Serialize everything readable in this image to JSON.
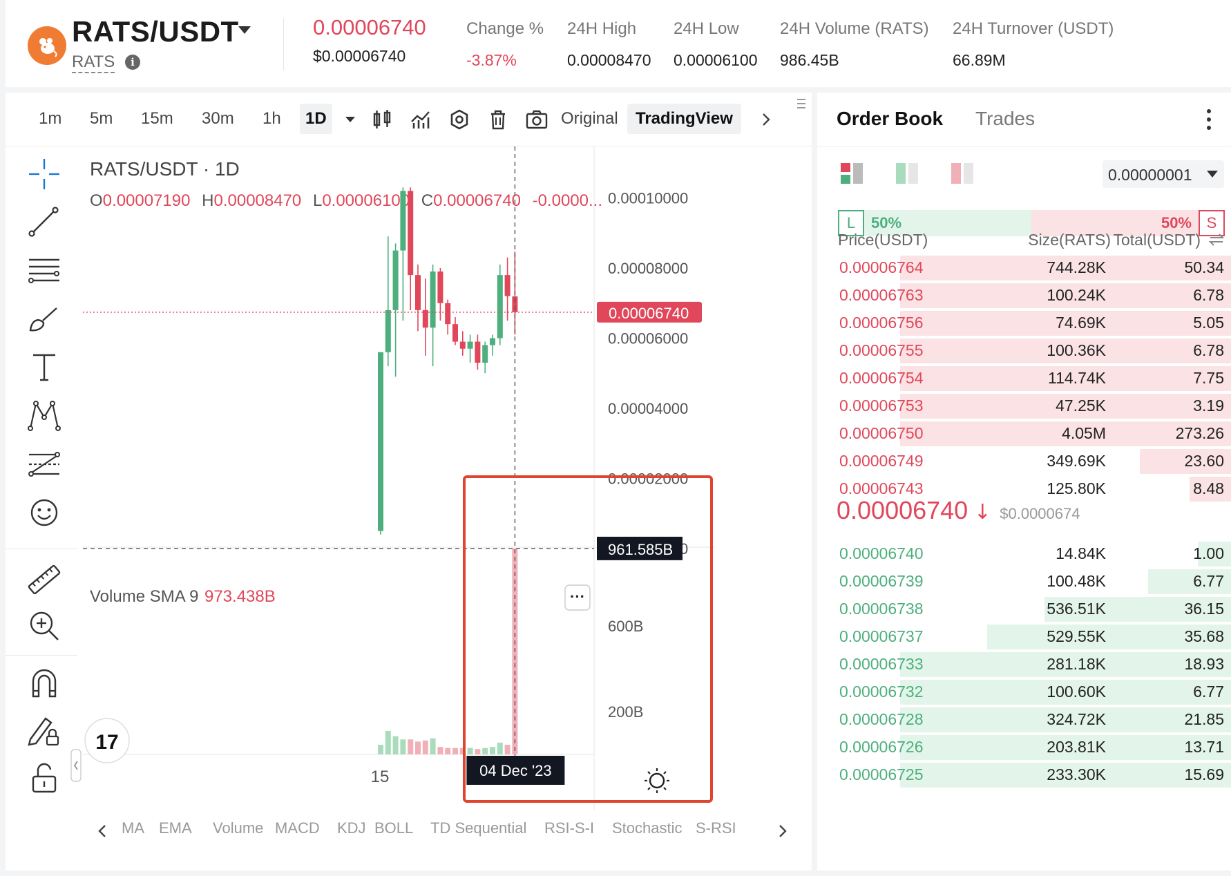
{
  "header": {
    "pair": "RATS/USDT",
    "base_symbol": "RATS",
    "info_glyph": "i",
    "last_price": "0.00006740",
    "last_price_usd": "$0.00006740",
    "stats": [
      {
        "label": "Change %",
        "value": "-3.87%",
        "color": "#e0475a"
      },
      {
        "label": "24H High",
        "value": "0.00008470",
        "color": "#222222"
      },
      {
        "label": "24H Low",
        "value": "0.00006100",
        "color": "#222222"
      },
      {
        "label": "24H Volume (RATS)",
        "value": "986.45B",
        "color": "#222222"
      },
      {
        "label": "24H Turnover (USDT)",
        "value": "66.89M",
        "color": "#222222"
      }
    ]
  },
  "toolbar": {
    "timeframes": [
      "1m",
      "5m",
      "15m",
      "30m",
      "1h",
      "1D"
    ],
    "active_timeframe": "1D",
    "view_original": "Original",
    "view_tradingview": "TradingView"
  },
  "chart": {
    "legend_title": "RATS/USDT · 1D",
    "ohlc": [
      {
        "k": "O",
        "v": "0.00007190"
      },
      {
        "k": "H",
        "v": "0.00008470"
      },
      {
        "k": "L",
        "v": "0.00006100"
      },
      {
        "k": "C",
        "v": "0.00006740"
      }
    ],
    "change_text": "-0.0000...",
    "volume_label": "Volume SMA 9",
    "volume_sma": "973.438B",
    "crosshair_volume": "961.585B",
    "crosshair_date": "04 Dec '23",
    "x_tick": "15",
    "more_glyph": "···",
    "tv_logo": "17",
    "price_axis": [
      "0.00010000",
      "0.00008000",
      "0.00006000",
      "0.00004000",
      "0.00002000",
      "0.00000000"
    ],
    "volume_axis": [
      "600B",
      "200B"
    ],
    "current_price_label": "0.00006740",
    "indicators": [
      "MA",
      "EMA",
      "Volume",
      "MACD",
      "KDJ",
      "BOLL",
      "TD Sequential",
      "RSI-S-I",
      "Stochastic",
      "S-RSI"
    ]
  },
  "chart_data": {
    "type": "candlestick",
    "title": "RATS/USDT · 1D",
    "ylim": [
      0,
      0.000106
    ],
    "volume_ylim": [
      0,
      1000
    ],
    "candles": [
      {
        "o": 5e-06,
        "h": 6e-06,
        "l": 4e-06,
        "c": 5.6e-05,
        "v": 45
      },
      {
        "o": 5.6e-05,
        "h": 8.9e-05,
        "l": 5.2e-05,
        "c": 6.8e-05,
        "v": 110
      },
      {
        "o": 6.8e-05,
        "h": 8.7e-05,
        "l": 4.9e-05,
        "c": 8.5e-05,
        "v": 85
      },
      {
        "o": 8.5e-05,
        "h": 0.000103,
        "l": 6.5e-05,
        "c": 0.000102,
        "v": 70
      },
      {
        "o": 0.000102,
        "h": 0.000103,
        "l": 6.8e-05,
        "c": 7.8e-05,
        "v": 70
      },
      {
        "o": 7.8e-05,
        "h": 8.1e-05,
        "l": 6.2e-05,
        "c": 6.8e-05,
        "v": 60
      },
      {
        "o": 6.8e-05,
        "h": 7.7e-05,
        "l": 5.5e-05,
        "c": 6.3e-05,
        "v": 65
      },
      {
        "o": 6.3e-05,
        "h": 8.1e-05,
        "l": 5.2e-05,
        "c": 7.9e-05,
        "v": 75
      },
      {
        "o": 7.9e-05,
        "h": 8e-05,
        "l": 6.5e-05,
        "c": 7e-05,
        "v": 35
      },
      {
        "o": 7e-05,
        "h": 7.1e-05,
        "l": 6.1e-05,
        "c": 6.4e-05,
        "v": 30
      },
      {
        "o": 6.4e-05,
        "h": 6.6e-05,
        "l": 5.8e-05,
        "c": 5.9e-05,
        "v": 30
      },
      {
        "o": 5.9e-05,
        "h": 6.2e-05,
        "l": 5.5e-05,
        "c": 5.7e-05,
        "v": 30
      },
      {
        "o": 5.7e-05,
        "h": 6.1e-05,
        "l": 5.3e-05,
        "c": 5.9e-05,
        "v": 30
      },
      {
        "o": 5.9e-05,
        "h": 6.1e-05,
        "l": 5.1e-05,
        "c": 5.3e-05,
        "v": 25
      },
      {
        "o": 5.3e-05,
        "h": 5.9e-05,
        "l": 5e-05,
        "c": 5.8e-05,
        "v": 30
      },
      {
        "o": 5.8e-05,
        "h": 6.1e-05,
        "l": 5.5e-05,
        "c": 6e-05,
        "v": 35
      },
      {
        "o": 6e-05,
        "h": 8.1e-05,
        "l": 5.8e-05,
        "c": 7.8e-05,
        "v": 55
      },
      {
        "o": 7.8e-05,
        "h": 8.3e-05,
        "l": 6.5e-05,
        "c": 7.2e-05,
        "v": 45
      },
      {
        "o": 7.19e-05,
        "h": 8.47e-05,
        "l": 6.1e-05,
        "c": 6.74e-05,
        "v": 961.585
      }
    ]
  },
  "orderbook": {
    "tab_orderbook": "Order Book",
    "tab_trades": "Trades",
    "precision": "0.00000001",
    "long_label": "L",
    "long_pct": "50%",
    "short_pct": "50%",
    "short_label": "S",
    "col_price": "Price(USDT)",
    "col_size": "Size(RATS)",
    "col_total": "Total(USDT)",
    "asks": [
      {
        "price": "0.00006764",
        "size": "744.28K",
        "total": "50.34",
        "depth": 0.8
      },
      {
        "price": "0.00006763",
        "size": "100.24K",
        "total": "6.78",
        "depth": 0.8
      },
      {
        "price": "0.00006756",
        "size": "74.69K",
        "total": "5.05",
        "depth": 0.8
      },
      {
        "price": "0.00006755",
        "size": "100.36K",
        "total": "6.78",
        "depth": 0.8
      },
      {
        "price": "0.00006754",
        "size": "114.74K",
        "total": "7.75",
        "depth": 0.8
      },
      {
        "price": "0.00006753",
        "size": "47.25K",
        "total": "3.19",
        "depth": 0.8
      },
      {
        "price": "0.00006750",
        "size": "4.05M",
        "total": "273.26",
        "depth": 0.8
      },
      {
        "price": "0.00006749",
        "size": "349.69K",
        "total": "23.60",
        "depth": 0.22
      },
      {
        "price": "0.00006743",
        "size": "125.80K",
        "total": "8.48",
        "depth": 0.1
      }
    ],
    "mid_price": "0.00006740",
    "mid_arrow": "↓",
    "mid_usd": "$0.0000674",
    "bids": [
      {
        "price": "0.00006740",
        "size": "14.84K",
        "total": "1.00",
        "depth": 0.08
      },
      {
        "price": "0.00006739",
        "size": "100.48K",
        "total": "6.77",
        "depth": 0.2
      },
      {
        "price": "0.00006738",
        "size": "536.51K",
        "total": "36.15",
        "depth": 0.45
      },
      {
        "price": "0.00006737",
        "size": "529.55K",
        "total": "35.68",
        "depth": 0.59
      },
      {
        "price": "0.00006733",
        "size": "281.18K",
        "total": "18.93",
        "depth": 0.8
      },
      {
        "price": "0.00006732",
        "size": "100.60K",
        "total": "6.77",
        "depth": 0.8
      },
      {
        "price": "0.00006728",
        "size": "324.72K",
        "total": "21.85",
        "depth": 0.8
      },
      {
        "price": "0.00006726",
        "size": "203.81K",
        "total": "13.71",
        "depth": 0.8
      },
      {
        "price": "0.00006725",
        "size": "233.30K",
        "total": "15.69",
        "depth": 0.8
      }
    ]
  },
  "colors": {
    "up": "#4caf7d",
    "down": "#e0475a",
    "ask_bg": "#fbe3e5",
    "bid_bg": "#e3f5ea",
    "highlight": "#e0442e",
    "accent": "#1976d2"
  }
}
